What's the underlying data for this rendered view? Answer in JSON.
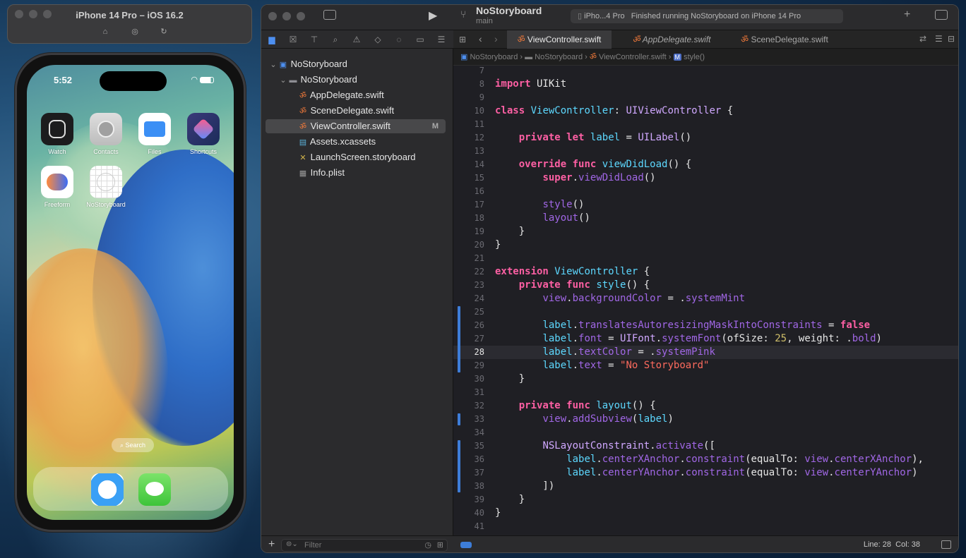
{
  "simulator": {
    "title": "iPhone 14 Pro – iOS 16.2",
    "time": "5:52",
    "apps": [
      {
        "label": "Watch",
        "icon": "watch-icon"
      },
      {
        "label": "Contacts",
        "icon": "contacts-icon"
      },
      {
        "label": "Files",
        "icon": "files-icon"
      },
      {
        "label": "Shortcuts",
        "icon": "shortcuts-icon"
      },
      {
        "label": "Freeform",
        "icon": "freeform-icon"
      },
      {
        "label": "NoStoryboard",
        "icon": "nostoryboard-icon"
      }
    ],
    "search_label": "Search",
    "dock": [
      {
        "icon": "safari-icon"
      },
      {
        "icon": "messages-icon"
      }
    ]
  },
  "xcode": {
    "project": "NoStoryboard",
    "branch": "main",
    "destination": "iPho...4 Pro",
    "status": "Finished running NoStoryboard on iPhone 14 Pro",
    "navigator": {
      "items": [
        {
          "label": "NoStoryboard",
          "badge": "",
          "icon": "project-icon"
        },
        {
          "label": "NoStoryboard",
          "badge": "",
          "icon": "folder-icon"
        },
        {
          "label": "AppDelegate.swift",
          "badge": "",
          "icon": "swift-file-icon"
        },
        {
          "label": "SceneDelegate.swift",
          "badge": "",
          "icon": "swift-file-icon"
        },
        {
          "label": "ViewController.swift",
          "badge": "M",
          "icon": "swift-file-icon"
        },
        {
          "label": "Assets.xcassets",
          "badge": "",
          "icon": "assets-icon"
        },
        {
          "label": "LaunchScreen.storyboard",
          "badge": "",
          "icon": "storyboard-icon"
        },
        {
          "label": "Info.plist",
          "badge": "",
          "icon": "plist-icon"
        }
      ],
      "filter_placeholder": "Filter"
    },
    "tabs": [
      "ViewController.swift",
      "AppDelegate.swift",
      "SceneDelegate.swift"
    ],
    "jumpbar": [
      "NoStoryboard",
      "NoStoryboard",
      "ViewController.swift",
      "style()"
    ],
    "cursor": {
      "line_label": "Line: 28",
      "col_label": "Col: 38"
    },
    "colors": {
      "keyword": "#fc5fa3",
      "type": "#5dd8ff",
      "string": "#fc6a5d",
      "number": "#d0bf69",
      "change_bar": "#3d7dd8"
    },
    "code": [
      {
        "n": "8",
        "text": "import UIKit"
      },
      {
        "n": "9",
        "text": ""
      },
      {
        "n": "10",
        "text": "class ViewController: UIViewController {"
      },
      {
        "n": "11",
        "text": ""
      },
      {
        "n": "12",
        "text": "    private let label = UILabel()"
      },
      {
        "n": "13",
        "text": ""
      },
      {
        "n": "14",
        "text": "    override func viewDidLoad() {"
      },
      {
        "n": "15",
        "text": "        super.viewDidLoad()"
      },
      {
        "n": "16",
        "text": ""
      },
      {
        "n": "17",
        "text": "        style()"
      },
      {
        "n": "18",
        "text": "        layout()"
      },
      {
        "n": "19",
        "text": "    }"
      },
      {
        "n": "20",
        "text": "}"
      },
      {
        "n": "21",
        "text": ""
      },
      {
        "n": "22",
        "text": "extension ViewController {"
      },
      {
        "n": "23",
        "text": "    private func style() {"
      },
      {
        "n": "24",
        "text": "        view.backgroundColor = .systemMint"
      },
      {
        "n": "25",
        "text": ""
      },
      {
        "n": "26",
        "text": "        label.translatesAutoresizingMaskIntoConstraints = false"
      },
      {
        "n": "27",
        "text": "        label.font = UIFont.systemFont(ofSize: 25, weight: .bold)"
      },
      {
        "n": "28",
        "text": "        label.textColor = .systemPink"
      },
      {
        "n": "29",
        "text": "        label.text = \"No Storyboard\""
      },
      {
        "n": "30",
        "text": "    }"
      },
      {
        "n": "31",
        "text": ""
      },
      {
        "n": "32",
        "text": "    private func layout() {"
      },
      {
        "n": "33",
        "text": "        view.addSubview(label)"
      },
      {
        "n": "34",
        "text": ""
      },
      {
        "n": "35",
        "text": "        NSLayoutConstraint.activate(["
      },
      {
        "n": "36",
        "text": "            label.centerXAnchor.constraint(equalTo: view.centerXAnchor),"
      },
      {
        "n": "37",
        "text": "            label.centerYAnchor.constraint(equalTo: view.centerYAnchor)"
      },
      {
        "n": "38",
        "text": "        ])"
      },
      {
        "n": "39",
        "text": "    }"
      },
      {
        "n": "40",
        "text": "}"
      },
      {
        "n": "41",
        "text": ""
      }
    ],
    "current_line": "28",
    "changed_lines": [
      "25",
      "26",
      "27",
      "28",
      "29",
      "33",
      "35",
      "36",
      "37",
      "38"
    ]
  }
}
